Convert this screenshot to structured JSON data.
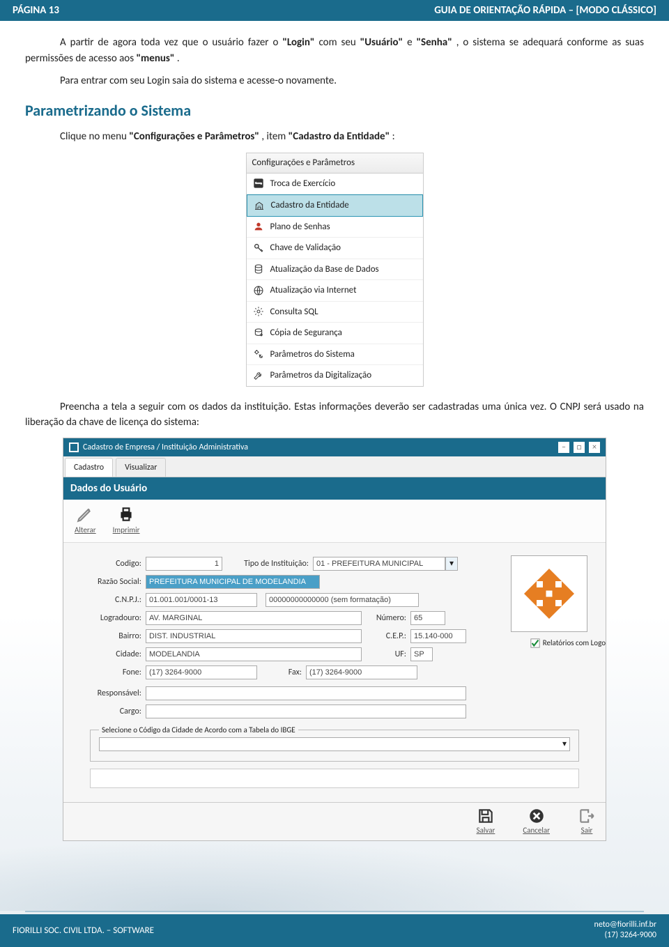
{
  "header": {
    "page": "PÁGINA 13",
    "guide": "GUIA DE ORIENTAÇÃO RÁPIDA – [MODO CLÁSSICO]"
  },
  "body": {
    "p1_a": "A partir de agora toda vez que o usuário fazer o ",
    "p1_login": "\"Login\"",
    "p1_b": " com seu ",
    "p1_usuario": "\"Usuário\"",
    "p1_c": " e ",
    "p1_senha": "\"Senha\"",
    "p1_d": ", o sistema se adequará conforme as suas permissões de acesso aos ",
    "p1_menus": "\"menus\"",
    "p1_e": ".",
    "p2": "Para entrar com seu Login saia do sistema e acesse-o novamente.",
    "section": "Parametrizando o Sistema",
    "p3_a": "Clique no menu ",
    "p3_b": "\"Configurações e Parâmetros\"",
    "p3_c": ", item ",
    "p3_d": "\"Cadastro da Entidade\"",
    "p3_e": ":",
    "p4": "Preencha a tela a seguir com os dados da instituição. Estas informações deverão ser cadastradas uma única vez. O CNPJ será usado na liberação da chave de licença do sistema:"
  },
  "menu": {
    "title": "Configurações e Parâmetros",
    "items": [
      "Troca de Exercício",
      "Cadastro da Entidade",
      "Plano de Senhas",
      "Chave de Validação",
      "Atualização da Base de Dados",
      "Atualização via Internet",
      "Consulta SQL",
      "Cópia de Segurança",
      "Parâmetros do Sistema",
      "Parâmetros da Digitalização"
    ]
  },
  "cad": {
    "title": "Cadastro de Empresa / Instituição Administrativa",
    "tabs": {
      "cadastro": "Cadastro",
      "visualizar": "Visualizar"
    },
    "subtitle": "Dados do Usuário",
    "toolbar": {
      "alterar": "Alterar",
      "imprimir": "Imprimir"
    },
    "labels": {
      "codigo": "Codigo:",
      "tipo": "Tipo de Instituição:",
      "razao": "Razão Social:",
      "cnpj": "C.N.P.J.:",
      "logradouro": "Logradouro:",
      "numero": "Número:",
      "bairro": "Bairro:",
      "cep": "C.E.P.:",
      "cidade": "Cidade:",
      "uf": "UF:",
      "fone": "Fone:",
      "fax": "Fax:",
      "responsavel": "Responsável:",
      "cargo": "Cargo:"
    },
    "values": {
      "codigo": "1",
      "tipo": "01 - PREFEITURA MUNICIPAL",
      "razao": "PREFEITURA MUNICIPAL DE MODELANDIA",
      "cnpj1": "01.001.001/0001-13",
      "cnpj2": "00000000000000 (sem formatação)",
      "logradouro": "AV. MARGINAL",
      "numero": "65",
      "bairro": "DIST. INDUSTRIAL",
      "cep": "15.140-000",
      "cidade": "MODELANDIA",
      "uf": "SP",
      "fone": "(17) 3264-9000",
      "fax": "(17) 3264-9000",
      "responsavel": "",
      "cargo": ""
    },
    "logo_chk": "Relatórios com Logo",
    "ibge_legend": "Selecione o Código da Cidade de Acordo com a Tabela do IBGE",
    "bottom": {
      "salvar": "Salvar",
      "cancelar": "Cancelar",
      "sair": "Sair"
    }
  },
  "footer": {
    "company": "FIORILLI SOC. CIVIL LTDA. – SOFTWARE",
    "email": "neto@fiorilli.inf.br",
    "phone": "(17) 3264-9000"
  }
}
